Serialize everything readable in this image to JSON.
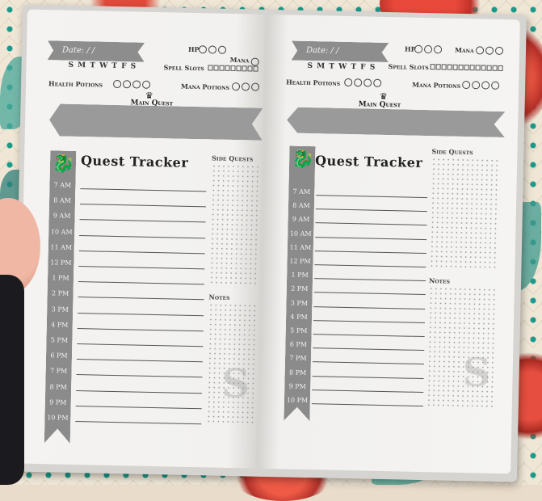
{
  "left_page": {
    "date_label": "Date:  /  /",
    "days": "S M T W T F S",
    "hp_label": "HP",
    "mana_label": "Mana",
    "spell_slots_label": "Spell Slots",
    "health_potions_label": "Health Potions",
    "mana_potions_label": "Mana Potions",
    "main_quest_label": "Main Quest",
    "quest_tracker_title": "Quest Tracker",
    "side_quests_label": "Side Quests",
    "notes_label": "Notes",
    "hours": [
      "7 AM",
      "8 AM",
      "9 AM",
      "10 AM",
      "11 AM",
      "12 PM",
      "1 PM",
      "2 PM",
      "3 PM",
      "4 PM",
      "5 PM",
      "6 PM",
      "7 PM",
      "8 PM",
      "9 PM",
      "10 PM"
    ]
  },
  "right_page": {
    "date_label": "Date:  /  /",
    "days": "S M T W T F S",
    "hp_label": "HP",
    "mana_label": "Mana",
    "spell_slots_label": "Spell Slots",
    "health_potions_label": "Health Potions",
    "mana_potions_label": "Mana Potions",
    "main_quest_label": "Main Quest",
    "quest_tracker_title": "Quest Tracker",
    "side_quests_label": "Side Quests",
    "notes_label": "Notes",
    "hours": [
      "7 AM",
      "8 AM",
      "9 AM",
      "10 AM",
      "11 AM",
      "12 PM",
      "1 PM",
      "2 PM",
      "3 PM",
      "4 PM",
      "5 PM",
      "6 PM",
      "7 PM",
      "8 PM",
      "9 PM",
      "10 PM"
    ]
  },
  "colors": {
    "banner_gray": "#8d8d8d",
    "paper": "#f4f3f1",
    "quilt_teal": "#1a9a8a",
    "flower_red": "#e8493a"
  },
  "icons": {
    "ribbon_emblem": "dragon-icon",
    "main_quest_emblem": "crown-icon",
    "watermark": "monogram-icon"
  }
}
